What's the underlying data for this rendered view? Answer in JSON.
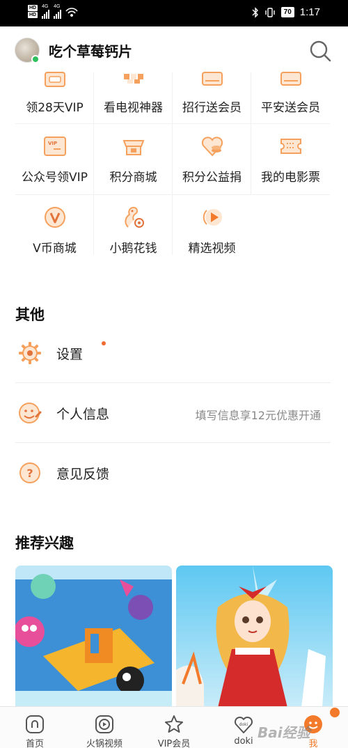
{
  "status_bar": {
    "sim1": "HD",
    "sim2": "HD",
    "network": "4G",
    "network2": "4G",
    "battery": "70",
    "time": "1:17",
    "icons": [
      "bluetooth-icon",
      "vibrate-icon",
      "wifi-hotspot-icon"
    ]
  },
  "header": {
    "username": "吃个草莓钙片",
    "avatar": "avatar-image",
    "search_icon": "search-icon"
  },
  "services": [
    {
      "label": "领28天VIP",
      "icon": "vip-28-icon"
    },
    {
      "label": "看电视神器",
      "icon": "tv-icon"
    },
    {
      "label": "招行送会员",
      "icon": "bank-card-icon"
    },
    {
      "label": "平安送会员",
      "icon": "insurance-icon"
    },
    {
      "label": "公众号领VIP",
      "icon": "vip-ticket-icon"
    },
    {
      "label": "积分商城",
      "icon": "points-mall-icon"
    },
    {
      "label": "积分公益捐",
      "icon": "charity-heart-icon"
    },
    {
      "label": "我的电影票",
      "icon": "movie-ticket-icon"
    },
    {
      "label": "V币商城",
      "icon": "v-coin-icon"
    },
    {
      "label": "小鹅花钱",
      "icon": "goose-icon"
    },
    {
      "label": "精选视频",
      "icon": "play-video-icon"
    }
  ],
  "other": {
    "title": "其他",
    "items": [
      {
        "label": "设置",
        "icon": "gear-icon",
        "hint": "",
        "has_dot": true
      },
      {
        "label": "个人信息",
        "icon": "smile-edit-icon",
        "hint": "填写信息享12元优惠开通",
        "has_dot": false
      },
      {
        "label": "意见反馈",
        "icon": "question-icon",
        "hint": "",
        "has_dot": false
      }
    ]
  },
  "recommended": {
    "title": "推荐兴趣",
    "cards": [
      {
        "image": "cartoon-game-illustration"
      },
      {
        "image": "christmas-girl-illustration"
      }
    ]
  },
  "bottom_nav": {
    "items": [
      {
        "label": "首页",
        "icon": "home-icon",
        "active": false
      },
      {
        "label": "火锅视频",
        "icon": "hotpot-video-icon",
        "active": false
      },
      {
        "label": "VIP会员",
        "icon": "vip-star-icon",
        "active": false
      },
      {
        "label": "doki",
        "icon": "doki-heart-icon",
        "active": false
      },
      {
        "label": "我",
        "icon": "me-face-icon",
        "active": true
      }
    ]
  },
  "watermark": "Bai经验",
  "colors": {
    "accent": "#f27a2a",
    "icon_orange": "#f5a15d",
    "online": "#2ec05c"
  }
}
